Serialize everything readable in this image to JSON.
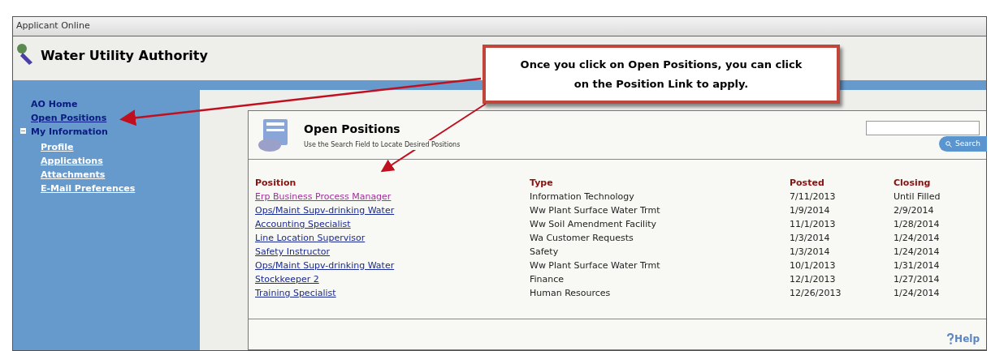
{
  "window": {
    "title": "Applicant Online"
  },
  "header": {
    "title": "Water Utility Authority"
  },
  "sidebar": {
    "items": [
      {
        "label": "AO Home",
        "selected": false
      },
      {
        "label": "Open Positions",
        "selected": true
      },
      {
        "label": "My Information",
        "selected": false,
        "expanded": true,
        "children": [
          {
            "label": "Profile"
          },
          {
            "label": "Applications"
          },
          {
            "label": "Attachments"
          },
          {
            "label": "E-Mail Preferences"
          }
        ]
      }
    ]
  },
  "callout": {
    "text": "Once you click on Open Positions, you can click on the Position Link to apply."
  },
  "panel": {
    "title": "Open Positions",
    "subtitle": "Use the Search Field to Locate Desired Positions",
    "search": {
      "button": "Search"
    },
    "table": {
      "columns": [
        "Position",
        "Type",
        "Posted",
        "Closing"
      ],
      "rows": [
        {
          "position": "Erp Business Process Manager",
          "visited": true,
          "type": "Information Technology",
          "posted": "7/11/2013",
          "closing": "Until Filled"
        },
        {
          "position": "Ops/Maint Supv-drinking Water",
          "visited": false,
          "type": "Ww Plant Surface Water Trmt",
          "posted": "1/9/2014",
          "closing": "2/9/2014"
        },
        {
          "position": "Accounting Specialist",
          "visited": false,
          "type": "Ww Soil Amendment Facility",
          "posted": "11/1/2013",
          "closing": "1/28/2014"
        },
        {
          "position": "Line Location Supervisor",
          "visited": false,
          "type": "Wa Customer Requests",
          "posted": "1/3/2014",
          "closing": "1/24/2014"
        },
        {
          "position": "Safety Instructor",
          "visited": false,
          "type": "Safety",
          "posted": "1/3/2014",
          "closing": "1/24/2014"
        },
        {
          "position": "Ops/Maint Supv-drinking Water",
          "visited": false,
          "type": "Ww Plant Surface Water Trmt",
          "posted": "10/1/2013",
          "closing": "1/31/2014"
        },
        {
          "position": "Stockkeeper 2",
          "visited": false,
          "type": "Finance",
          "posted": "12/1/2013",
          "closing": "1/27/2014"
        },
        {
          "position": "Training Specialist",
          "visited": false,
          "type": "Human Resources",
          "posted": "12/26/2013",
          "closing": "1/24/2014"
        }
      ]
    },
    "help": "Help"
  }
}
